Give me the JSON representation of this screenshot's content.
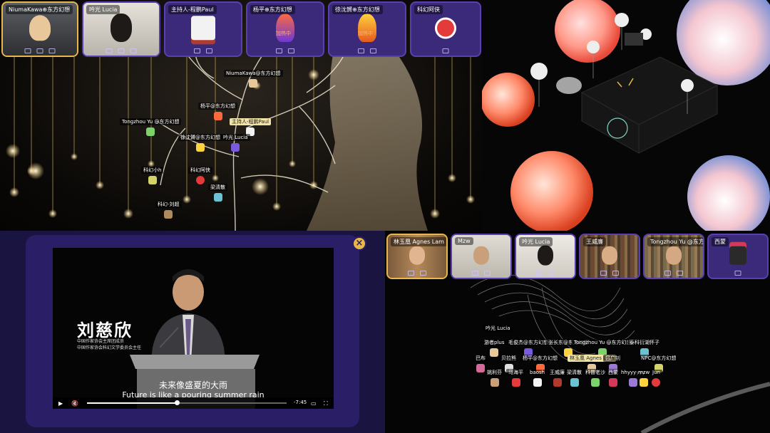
{
  "top_left": {
    "tiles": [
      {
        "name": "NiumaKawa⊕东方幻想"
      },
      {
        "name": "吟光 Lucia"
      },
      {
        "name": "主持人-程鹏Paul"
      },
      {
        "name": "杨平⊕东方幻想"
      },
      {
        "name": "徐沈贇⊕东方幻想"
      },
      {
        "name": "科幻阿侠"
      }
    ],
    "tile_badges": [
      "加热中",
      "加热中"
    ],
    "avatars": [
      {
        "label": "NiumaKawa@东方幻想",
        "host": false
      },
      {
        "label": "杨平@东方幻想",
        "host": false
      },
      {
        "label": "Tongzhou Yu @东方幻想",
        "host": false
      },
      {
        "label": "主持人-程鹏Paul",
        "host": true
      },
      {
        "label": "徐沈贇@东方幻想",
        "host": false
      },
      {
        "label": "吟光 Lucia",
        "host": false
      },
      {
        "label": "科幻小h",
        "host": false
      },
      {
        "label": "科幻阿侠",
        "host": false
      },
      {
        "label": "梁清散",
        "host": false
      },
      {
        "label": "科幻-刘超",
        "host": false
      }
    ]
  },
  "bottom_left": {
    "speaker_name": "刘慈欣",
    "speaker_title_1": "中国作家协会主席团成员",
    "speaker_title_2": "中国作家协会科幻文学委员会主任",
    "subtitle_cn": "未来像盛夏的大雨",
    "subtitle_en": "Future is like a pouring summer rain",
    "timecode": "-7:45",
    "progress": 0.45,
    "close_icon": "×"
  },
  "bottom_right": {
    "tiles": [
      {
        "name": "林玉凰 Agnes Lam"
      },
      {
        "name": "Mzw"
      },
      {
        "name": "吟光 Lucia"
      },
      {
        "name": "王威廉"
      },
      {
        "name": "Tongzhou Yu @东方幻想"
      },
      {
        "name": "西蒙"
      }
    ],
    "avatars": [
      {
        "label": "吟光 Lucia",
        "host": false
      },
      {
        "label": "游者plus",
        "host": false
      },
      {
        "label": "毛俊杰@东方幻想",
        "host": false
      },
      {
        "label": "张长东@东方幻想",
        "host": false
      },
      {
        "label": "Tongzhou Yu @东方幻想",
        "host": false
      },
      {
        "label": "泰科衍湖怀子",
        "host": false
      },
      {
        "label": "巴布",
        "host": false
      },
      {
        "label": "贝拉熊",
        "host": false
      },
      {
        "label": "杨平@东方幻想",
        "host": false
      },
      {
        "label": "林玉凰 Agnes Lam",
        "host": true
      },
      {
        "label": "吕广钊",
        "host": false
      },
      {
        "label": "NPC@东方幻想",
        "host": false
      },
      {
        "label": "姚利芬",
        "host": false
      },
      {
        "label": "马海平",
        "host": false
      },
      {
        "label": "baosh",
        "host": false
      },
      {
        "label": "王威廉",
        "host": false
      },
      {
        "label": "梁清散",
        "host": false
      },
      {
        "label": "科普老沙",
        "host": false
      },
      {
        "label": "西蒙",
        "host": false
      },
      {
        "label": "hhyyyyyy",
        "host": false
      },
      {
        "label": "mzw",
        "host": false
      },
      {
        "label": "Jun",
        "host": false
      }
    ]
  }
}
